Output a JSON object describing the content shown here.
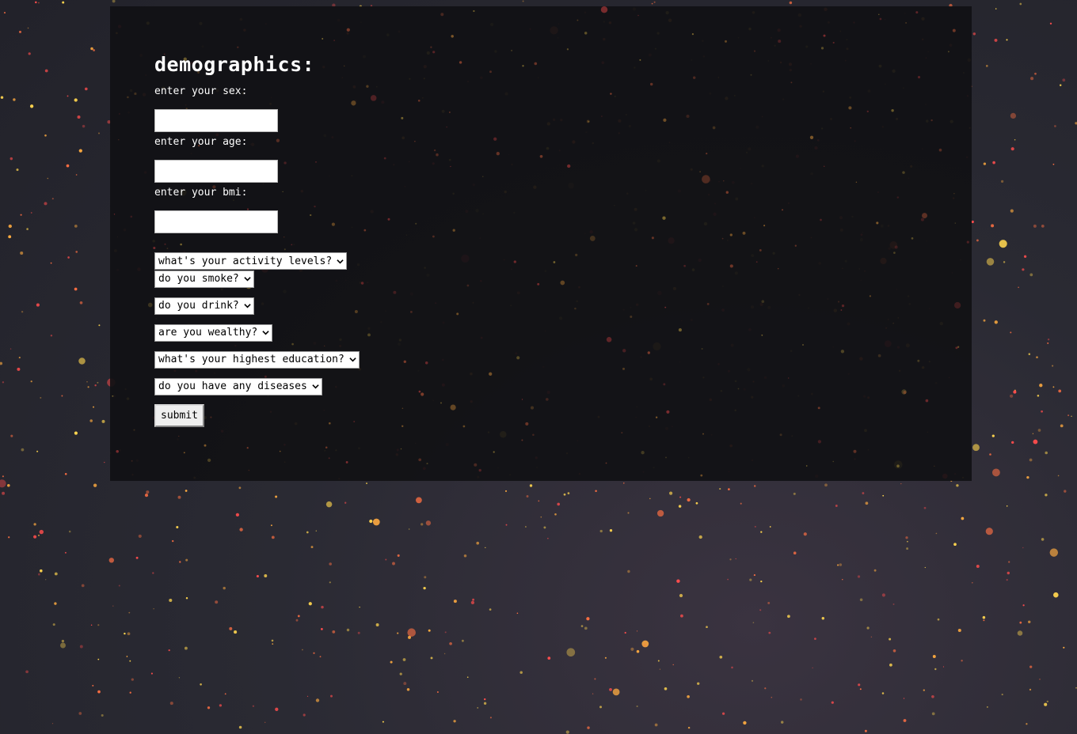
{
  "form": {
    "title": "Demographics:",
    "fields": [
      {
        "label": "Enter your sex:",
        "value": ""
      },
      {
        "label": "Enter your age:",
        "value": ""
      },
      {
        "label": "Enter your BMI:",
        "value": ""
      }
    ],
    "selects": [
      {
        "selected": "What's your activity levels?"
      },
      {
        "selected": "Do you smoke?"
      },
      {
        "selected": "Do you drink?"
      },
      {
        "selected": "Are you wealthy?"
      },
      {
        "selected": "What's your highest education?"
      },
      {
        "selected": "Do you have any diseases"
      }
    ],
    "submit_label": "Submit"
  },
  "theme": {
    "panel_color": "#111114",
    "text_color": "#ffffff",
    "star_colors": [
      "#ff4d4d",
      "#ff7043",
      "#ffd54f",
      "#ffab40"
    ]
  },
  "icons": {
    "select_arrow": "chevron-down-icon"
  }
}
